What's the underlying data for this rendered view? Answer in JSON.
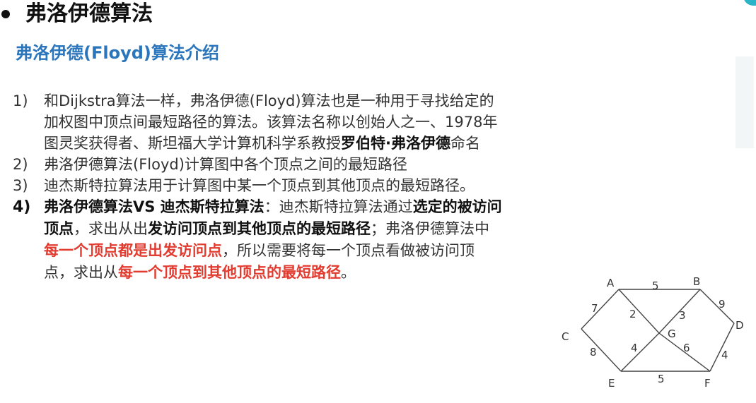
{
  "header": {
    "title": "弗洛伊德算法"
  },
  "subtitle": "弗洛伊德(Floyd)算法介绍",
  "items": [
    {
      "num": "1)",
      "parts": [
        {
          "t": "和Dijkstra算法一样，弗洛伊德(Floyd)算法也是一种用于寻找给定的加权图中顶点间最短路径的算法。该算法名称以创始人之一、1978年图灵奖获得者、斯坦福大学计算机科学系教授"
        },
        {
          "t": "罗伯特·弗洛伊德",
          "style": "b"
        },
        {
          "t": "命名"
        }
      ]
    },
    {
      "num": "2)",
      "parts": [
        {
          "t": "弗洛伊德算法(Floyd)计算图中各个顶点之间的最短路径"
        }
      ]
    },
    {
      "num": "3)",
      "parts": [
        {
          "t": "迪杰斯特拉算法用于计算图中某一个顶点到其他顶点的最短路径。"
        }
      ]
    },
    {
      "num": "4)",
      "parts": [
        {
          "t": "弗洛伊德算法VS 迪杰斯特拉算法",
          "style": "b"
        },
        {
          "t": "：迪杰斯特拉算法通过"
        },
        {
          "t": "选定的被访问顶点",
          "style": "b"
        },
        {
          "t": "，求出从出"
        },
        {
          "t": "发访问顶点到其他顶点的最短路径",
          "style": "b"
        },
        {
          "t": "；弗洛伊德算法中"
        },
        {
          "t": "每一个顶点都是出发访问点",
          "style": "red"
        },
        {
          "t": "，所以需要将每一个顶点看做被访问顶点，求出从"
        },
        {
          "t": "每一个顶点到其他顶点的最短路径",
          "style": "red"
        },
        {
          "t": "。"
        }
      ]
    }
  ],
  "graph": {
    "nodes": [
      "A",
      "B",
      "C",
      "D",
      "E",
      "F",
      "G"
    ],
    "edges": [
      {
        "from": "A",
        "to": "B",
        "weight": "5"
      },
      {
        "from": "A",
        "to": "C",
        "weight": "7"
      },
      {
        "from": "A",
        "to": "G",
        "weight": "2"
      },
      {
        "from": "B",
        "to": "G",
        "weight": "3"
      },
      {
        "from": "B",
        "to": "D",
        "weight": "9"
      },
      {
        "from": "C",
        "to": "E",
        "weight": "8"
      },
      {
        "from": "E",
        "to": "G",
        "weight": "4"
      },
      {
        "from": "G",
        "to": "F",
        "weight": "6"
      },
      {
        "from": "D",
        "to": "F",
        "weight": "4"
      },
      {
        "from": "E",
        "to": "F",
        "weight": "5"
      }
    ]
  },
  "colors": {
    "title": "#111111",
    "subtitle": "#2a75bb",
    "emphasis_red": "#e23b2f",
    "accent": "#2bb3c7"
  }
}
